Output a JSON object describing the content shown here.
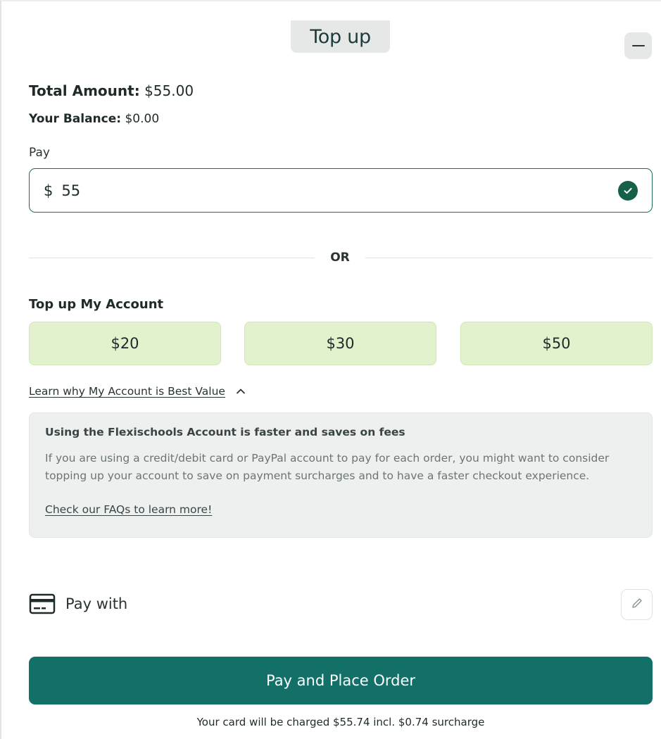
{
  "header": {
    "title": "Top up"
  },
  "summary": {
    "total_label": "Total Amount:",
    "total_value": "$55.00",
    "balance_label": "Your Balance:",
    "balance_value": "$0.00"
  },
  "pay": {
    "label": "Pay",
    "currency_symbol": "$",
    "value": "55"
  },
  "divider": {
    "text": "OR"
  },
  "topup": {
    "heading": "Top up My Account",
    "amounts": [
      "$20",
      "$30",
      "$50"
    ]
  },
  "learn": {
    "link": "Learn why My Account is Best Value"
  },
  "info": {
    "title": "Using the Flexischools Account is faster and saves on fees",
    "body": "If you are using a credit/debit card or PayPal account to pay for each order, you might want to consider topping up your account to save on payment surcharges and to have a faster checkout experience.",
    "link": "Check our FAQs to learn more!"
  },
  "payment": {
    "label": "Pay with"
  },
  "action": {
    "button": "Pay and Place Order",
    "note": "Your card will be charged $55.74 incl. $0.74 surcharge"
  },
  "colors": {
    "primary": "#137068",
    "success": "#16604a",
    "amount_bg": "#e1f2cc",
    "info_bg": "#eef0f0"
  },
  "icons": [
    "minus-icon",
    "check-circle-icon",
    "chevron-up-icon",
    "credit-card-icon",
    "pencil-icon"
  ]
}
